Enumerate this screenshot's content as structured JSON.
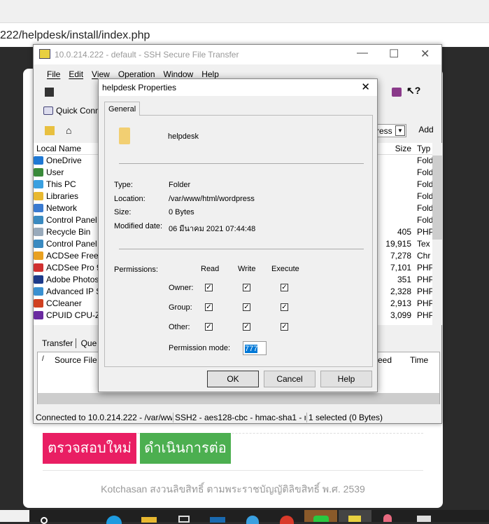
{
  "browser": {
    "url": "222/helpdesk/install/index.php"
  },
  "ssh": {
    "title": "10.0.214.222 - default - SSH Secure File Transfer",
    "menu": [
      "File",
      "Edit",
      "View",
      "Operation",
      "Window",
      "Help"
    ],
    "quick_connect": "Quick Conn",
    "address_dropdown": "ress",
    "add_button": "Add",
    "local_columns": {
      "name": "Local Name"
    },
    "remote_columns": {
      "size": "Size",
      "type": "Typ"
    },
    "local_items": [
      {
        "name": "OneDrive",
        "icon": "cloud-icon",
        "color": "#1e78d4"
      },
      {
        "name": "User",
        "icon": "user-icon",
        "color": "#3a8a3a"
      },
      {
        "name": "This PC",
        "icon": "monitor-icon",
        "color": "#3aa0e0"
      },
      {
        "name": "Libraries",
        "icon": "library-icon",
        "color": "#e8b830"
      },
      {
        "name": "Network",
        "icon": "network-icon",
        "color": "#3a7ad0"
      },
      {
        "name": "Control Panel",
        "icon": "control-panel-icon",
        "color": "#3a8ac0"
      },
      {
        "name": "Recycle Bin",
        "icon": "recycle-bin-icon",
        "color": "#9ab"
      },
      {
        "name": "Control Panel",
        "icon": "control-panel-icon",
        "color": "#3a8ac0"
      },
      {
        "name": "ACDSee Free",
        "icon": "acdsee-icon",
        "color": "#e8a020"
      },
      {
        "name": "ACDSee Pro 9",
        "icon": "acdsee-pro-icon",
        "color": "#d03030"
      },
      {
        "name": "Adobe Photos",
        "icon": "photoshop-icon",
        "color": "#1c3a8a"
      },
      {
        "name": "Advanced IP S",
        "icon": "ip-scanner-icon",
        "color": "#3a90d0"
      },
      {
        "name": "CCleaner",
        "icon": "ccleaner-icon",
        "color": "#d04020"
      },
      {
        "name": "CPUID CPU-Z",
        "icon": "cpuz-icon",
        "color": "#6a2aa0"
      }
    ],
    "remote_items": [
      {
        "size": "",
        "type": "Fold"
      },
      {
        "size": "",
        "type": "Fold"
      },
      {
        "size": "",
        "type": "Fold"
      },
      {
        "size": "",
        "type": "Fold"
      },
      {
        "size": "",
        "type": "Fold"
      },
      {
        "size": "",
        "type": "Fold"
      },
      {
        "size": "405",
        "type": "PHP"
      },
      {
        "size": "19,915",
        "type": "Tex"
      },
      {
        "size": "7,278",
        "type": "Chr"
      },
      {
        "size": "7,101",
        "type": "PHP"
      },
      {
        "size": "351",
        "type": "PHP"
      },
      {
        "size": "2,328",
        "type": "PHP"
      },
      {
        "size": "2,913",
        "type": "PHP"
      },
      {
        "size": "3,099",
        "type": "PHP"
      }
    ],
    "transfer_tabs": [
      "Transfer",
      "Que"
    ],
    "transfer_columns": [
      "/",
      "Source File",
      "eed",
      "Time"
    ],
    "status": [
      "Connected to 10.0.214.222 - /var/ww",
      "SSH2 - aes128-cbc - hmac-sha1 - nc",
      "1 selected (0 Bytes)"
    ]
  },
  "dialog": {
    "title": "helpdesk Properties",
    "tab": "General",
    "name": "helpdesk",
    "fields": [
      {
        "label": "Type:",
        "value": "Folder"
      },
      {
        "label": "Location:",
        "value": "/var/www/html/wordpress"
      },
      {
        "label": "Size:",
        "value": "0 Bytes"
      },
      {
        "label": "Modified date:",
        "value": "06 มีนาคม 2021 07:44:48"
      }
    ],
    "permissions_label": "Permissions:",
    "perm_columns": [
      "Read",
      "Write",
      "Execute"
    ],
    "perm_rows": [
      {
        "label": "Owner:",
        "values": [
          true,
          true,
          true
        ]
      },
      {
        "label": "Group:",
        "values": [
          true,
          true,
          true
        ]
      },
      {
        "label": "Other:",
        "values": [
          true,
          true,
          true
        ]
      }
    ],
    "mode_label": "Permission mode:",
    "mode_value": "777",
    "buttons": {
      "ok": "OK",
      "cancel": "Cancel",
      "help": "Help"
    }
  },
  "page": {
    "recheck_button": "ตรวจสอบใหม่",
    "continue_button": "ดำเนินการต่อ",
    "recheck_color": "#e91e63",
    "continue_color": "#4caf50",
    "footer": "Kotchasan สงวนลิขสิทธิ์ ตามพระราชบัญญัติลิขสิทธิ์ พ.ศ. 2539"
  }
}
